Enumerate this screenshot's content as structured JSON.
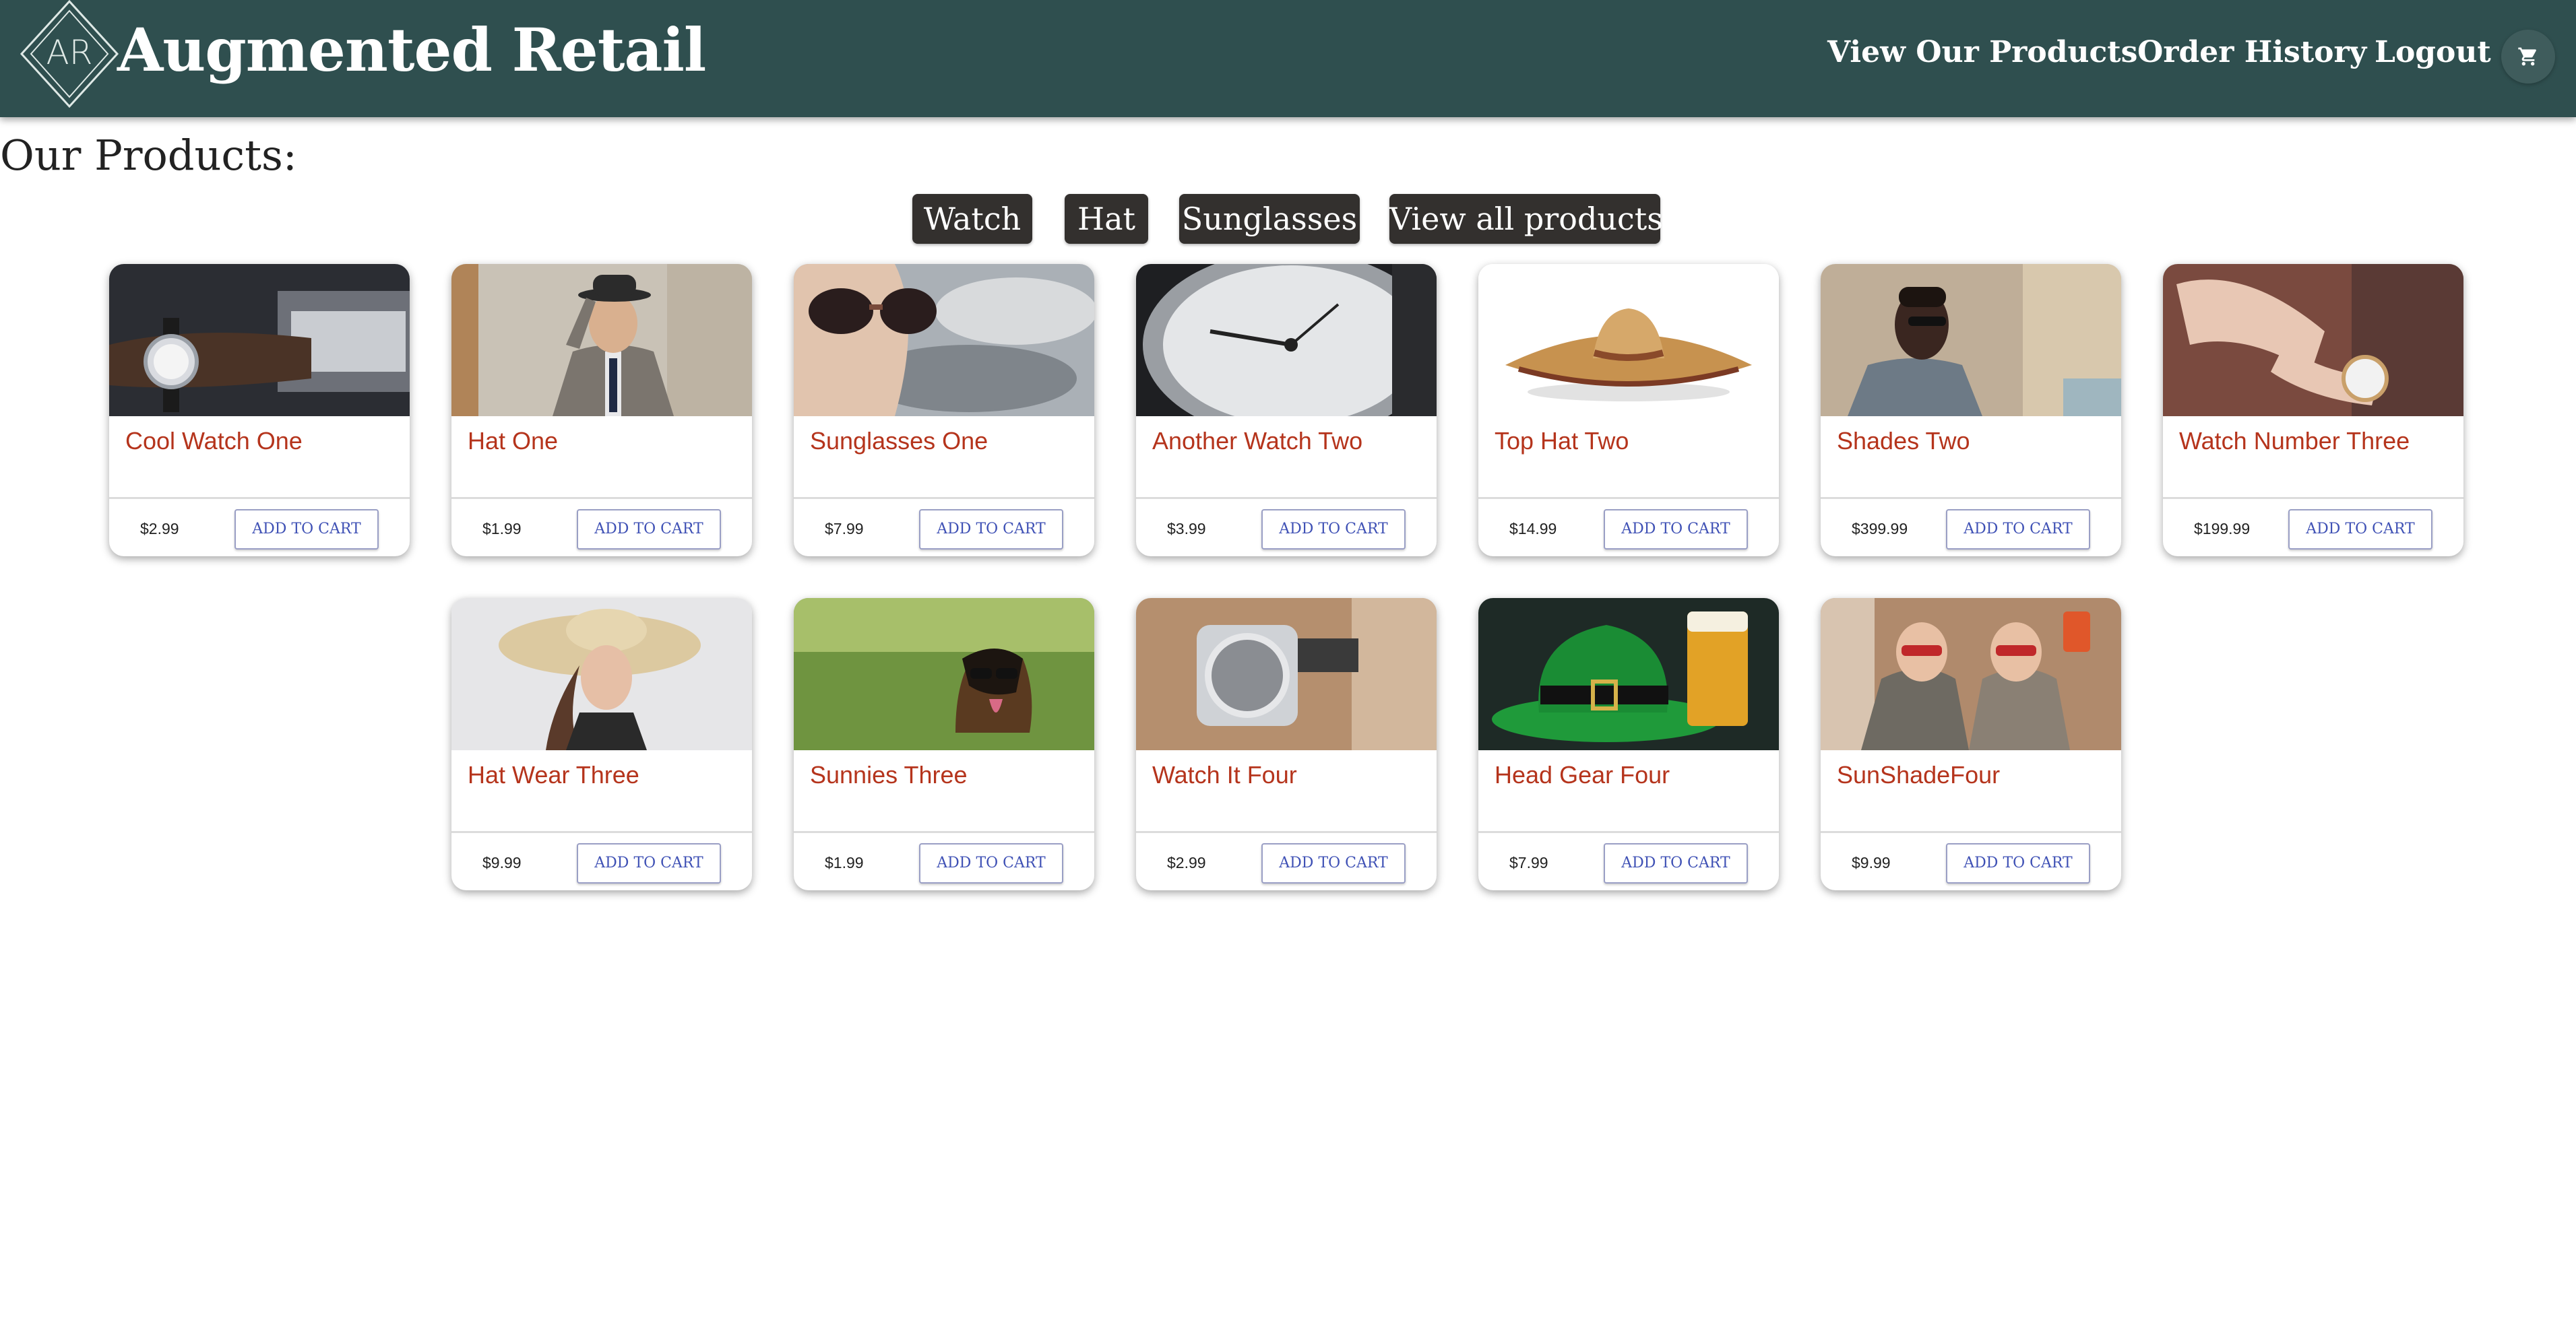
{
  "header": {
    "logo_letters": "AR",
    "brand": "Augmented Retail",
    "nav": [
      "View Our Products",
      "Order History",
      "Logout"
    ]
  },
  "page": {
    "title": "Our Products:",
    "filters": [
      "Watch",
      "Hat",
      "Sunglasses",
      "View all products"
    ]
  },
  "cart_button_label": "ADD TO CART",
  "products": [
    {
      "name": "Cool Watch One",
      "price": "$2.99",
      "image": "watch-on-wrist-image"
    },
    {
      "name": "Hat One",
      "price": "$1.99",
      "image": "man-in-bowler-hat-image"
    },
    {
      "name": "Sunglasses One",
      "price": "$7.99",
      "image": "woman-sunglasses-image"
    },
    {
      "name": "Another Watch Two",
      "price": "$3.99",
      "image": "pocket-watch-image"
    },
    {
      "name": "Top Hat Two",
      "price": "$14.99",
      "image": "sombrero-image"
    },
    {
      "name": "Shades Two",
      "price": "$399.99",
      "image": "man-in-shades-image"
    },
    {
      "name": "Watch Number Three",
      "price": "$199.99",
      "image": "woman-wrist-watch-image"
    },
    {
      "name": "Hat Wear Three",
      "price": "$9.99",
      "image": "woman-sun-hat-image"
    },
    {
      "name": "Sunnies Three",
      "price": "$1.99",
      "image": "dog-sunglasses-image"
    },
    {
      "name": "Watch It Four",
      "price": "$2.99",
      "image": "watch-mechanism-image"
    },
    {
      "name": "Head Gear Four",
      "price": "$7.99",
      "image": "green-hat-beer-image"
    },
    {
      "name": "SunShadeFour",
      "price": "$9.99",
      "image": "women-party-sunglasses-image"
    }
  ]
}
